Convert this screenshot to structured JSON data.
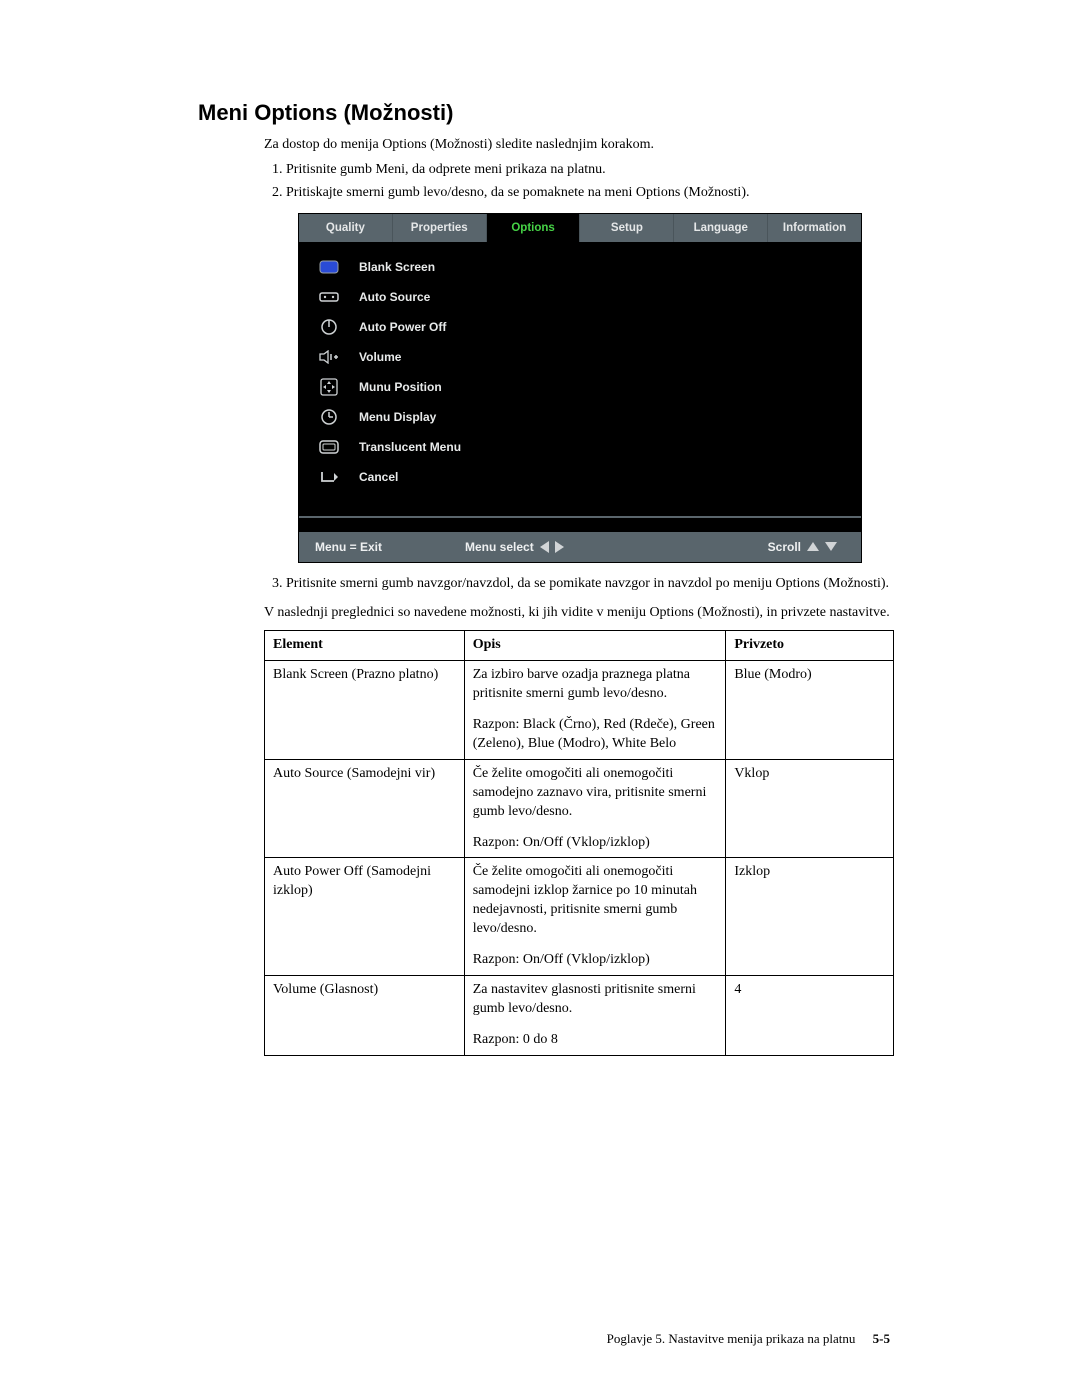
{
  "heading": "Meni Options (Možnosti)",
  "intro": "Za dostop do menija Options (Možnosti) sledite naslednjim korakom.",
  "steps12": [
    "Pritisnite gumb Meni, da odprete meni prikaza na platnu.",
    "Pritiskajte smerni gumb levo/desno, da se pomaknete na meni Options (Možnosti)."
  ],
  "osd": {
    "tabs": [
      {
        "label": "Quality",
        "active": false
      },
      {
        "label": "Properties",
        "active": false
      },
      {
        "label": "Options",
        "active": true
      },
      {
        "label": "Setup",
        "active": false
      },
      {
        "label": "Language",
        "active": false
      },
      {
        "label": "Information",
        "active": false
      }
    ],
    "items": [
      {
        "icon": "blank-screen-icon",
        "label": "Blank Screen"
      },
      {
        "icon": "auto-source-icon",
        "label": "Auto Source"
      },
      {
        "icon": "auto-power-off-icon",
        "label": "Auto Power Off"
      },
      {
        "icon": "volume-icon",
        "label": "Volume"
      },
      {
        "icon": "menu-position-icon",
        "label": "Munu Position"
      },
      {
        "icon": "menu-display-icon",
        "label": "Menu Display"
      },
      {
        "icon": "translucent-menu-icon",
        "label": "Translucent Menu"
      },
      {
        "icon": "cancel-icon",
        "label": "Cancel"
      }
    ],
    "footer": {
      "exit": "Menu = Exit",
      "select": "Menu select",
      "scroll": "Scroll"
    }
  },
  "step3": "Pritisnite smerni gumb navzgor/navzdol, da se pomikate navzgor in navzdol po meniju Options (Možnosti).",
  "tableIntro": "V naslednji preglednici so navedene možnosti, ki jih vidite v meniju Options (Možnosti), in privzete nastavitve.",
  "table": {
    "headers": {
      "element": "Element",
      "opis": "Opis",
      "privzeto": "Privzeto"
    },
    "rows": [
      {
        "element": "Blank Screen (Prazno platno)",
        "opis1": "Za izbiro barve ozadja praznega platna pritisnite smerni gumb levo/desno.",
        "opis2": "Razpon: Black (Črno), Red (Rdeče), Green (Zeleno), Blue (Modro), White Belo",
        "privzeto": "Blue (Modro)"
      },
      {
        "element": "Auto Source (Samodejni vir)",
        "opis1": "Če želite omogočiti ali onemogočiti samodejno zaznavo vira, pritisnite smerni gumb levo/desno.",
        "opis2": "Razpon: On/Off (Vklop/izklop)",
        "privzeto": "Vklop"
      },
      {
        "element": "Auto Power Off (Samodejni izklop)",
        "opis1": "Če želite omogočiti ali onemogočiti samodejni izklop žarnice po 10 minutah nedejavnosti, pritisnite smerni gumb levo/desno.",
        "opis2": "Razpon: On/Off (Vklop/izklop)",
        "privzeto": "Izklop"
      },
      {
        "element": "Volume (Glasnost)",
        "opis1": "Za nastavitev glasnosti pritisnite smerni gumb levo/desno.",
        "opis2": "Razpon: 0 do 8",
        "privzeto": "4"
      }
    ]
  },
  "footer": {
    "chapter": "Poglavje 5. Nastavitve menija prikaza na platnu",
    "page": "5-5"
  }
}
